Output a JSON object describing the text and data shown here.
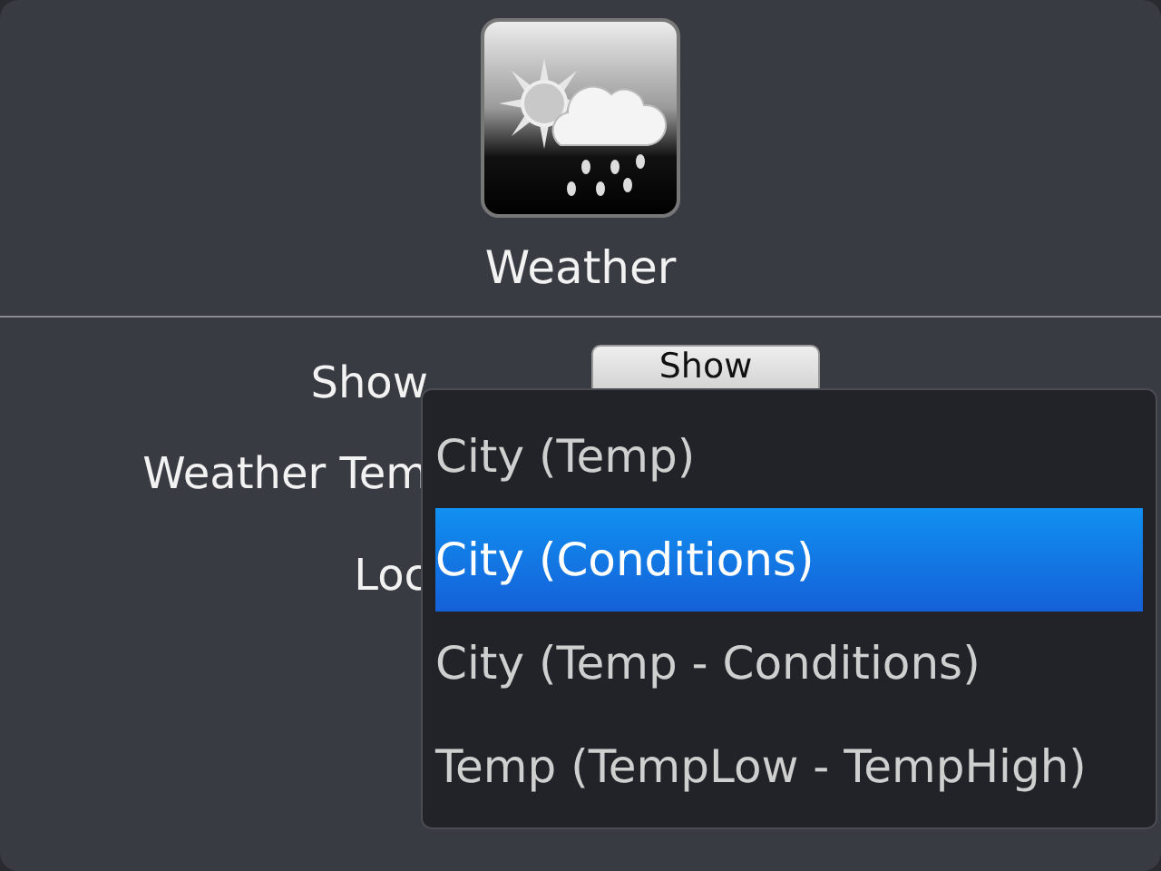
{
  "app": {
    "name": "Weather"
  },
  "settings": [
    {
      "label": "Show",
      "button": "Show"
    },
    {
      "label": "Weather Tem"
    },
    {
      "label": "Loc"
    }
  ],
  "dropdown": {
    "options": [
      {
        "label": "City (Temp)",
        "selected": false
      },
      {
        "label": "City (Conditions)",
        "selected": true
      },
      {
        "label": "City (Temp - Conditions)",
        "selected": false
      },
      {
        "label": "Temp (TempLow - TempHigh)",
        "selected": false
      }
    ]
  }
}
